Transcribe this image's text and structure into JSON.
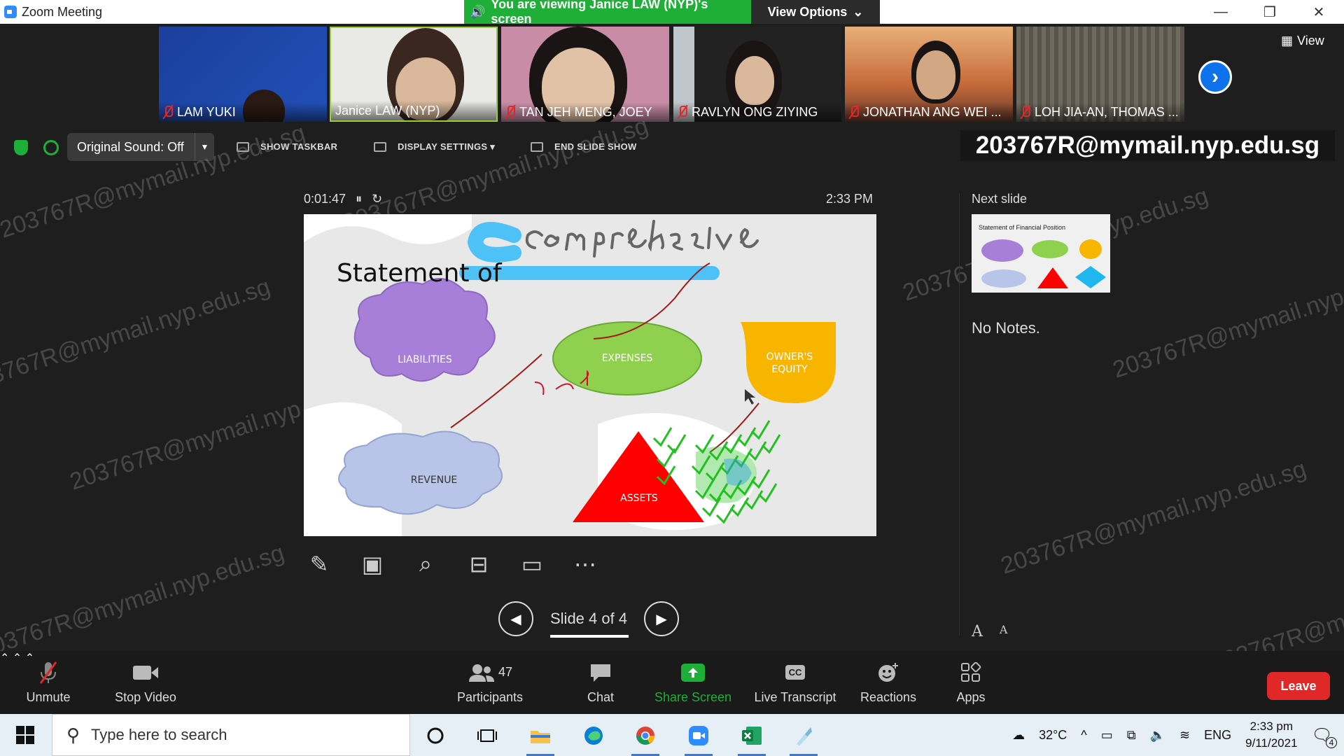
{
  "window": {
    "title": "Zoom Meeting",
    "viewing_banner": "You are viewing Janice LAW (NYP)'s screen",
    "view_options": "View Options",
    "min": "—",
    "restore": "❐",
    "close": "✕"
  },
  "participants_strip": [
    {
      "name": "LAM YUKI",
      "muted": true
    },
    {
      "name": "Janice LAW (NYP)",
      "muted": false
    },
    {
      "name": "TAN JEH MENG, JOEY",
      "muted": true
    },
    {
      "name": "RAVLYN ONG ZIYING",
      "muted": true
    },
    {
      "name": "JONATHAN ANG WEI ...",
      "muted": true
    },
    {
      "name": "LOH JIA-AN, THOMAS ...",
      "muted": true
    }
  ],
  "view_button": "View",
  "share_toolbar": {
    "original_sound": "Original Sound: Off",
    "show_taskbar": "SHOW TASKBAR",
    "display_settings": "DISPLAY SETTINGS ▾",
    "end_slide_show": "END SLIDE SHOW"
  },
  "watermark_id": "203767R@mymail.nyp.edu.sg",
  "presenter": {
    "timer": "0:01:47",
    "clock": "2:33 PM",
    "slide_title": "Statement of",
    "handwriting": "comprehensive",
    "shapes": {
      "liabilities": "LIABILITIES",
      "expenses": "EXPENSES",
      "owners_equity_1": "OWNER'S",
      "owners_equity_2": "EQUITY",
      "revenue": "REVENUE",
      "assets": "ASSETS"
    },
    "slide_counter": "Slide 4 of 4",
    "progress_fraction": 1.0
  },
  "next_slide": {
    "label": "Next slide",
    "thumb_title": "Statement of Financial Position",
    "notes": "No Notes."
  },
  "font_ctrls": {
    "increase": "A",
    "decrease": "A"
  },
  "bottom_bar": {
    "unmute": "Unmute",
    "stop_video": "Stop Video",
    "participants": "Participants",
    "participant_count": "47",
    "chat": "Chat",
    "share_screen": "Share Screen",
    "live_transcript": "Live Transcript",
    "cc": "CC",
    "reactions": "Reactions",
    "apps": "Apps",
    "leave": "Leave"
  },
  "taskbar": {
    "search_placeholder": "Type here to search",
    "temperature": "32°C",
    "language": "ENG",
    "time": "2:33 pm",
    "date": "9/11/2021",
    "notifications": "4"
  },
  "colors": {
    "zoom_blue": "#2d8cff",
    "banner_green": "#1fae38",
    "leave_red": "#e02828",
    "share_green": "#1fae38",
    "liabilities": "#a77fd9",
    "expenses": "#8fd14f",
    "equity": "#f7b500",
    "revenue": "#b8c4e8",
    "assets": "#ff0000"
  }
}
